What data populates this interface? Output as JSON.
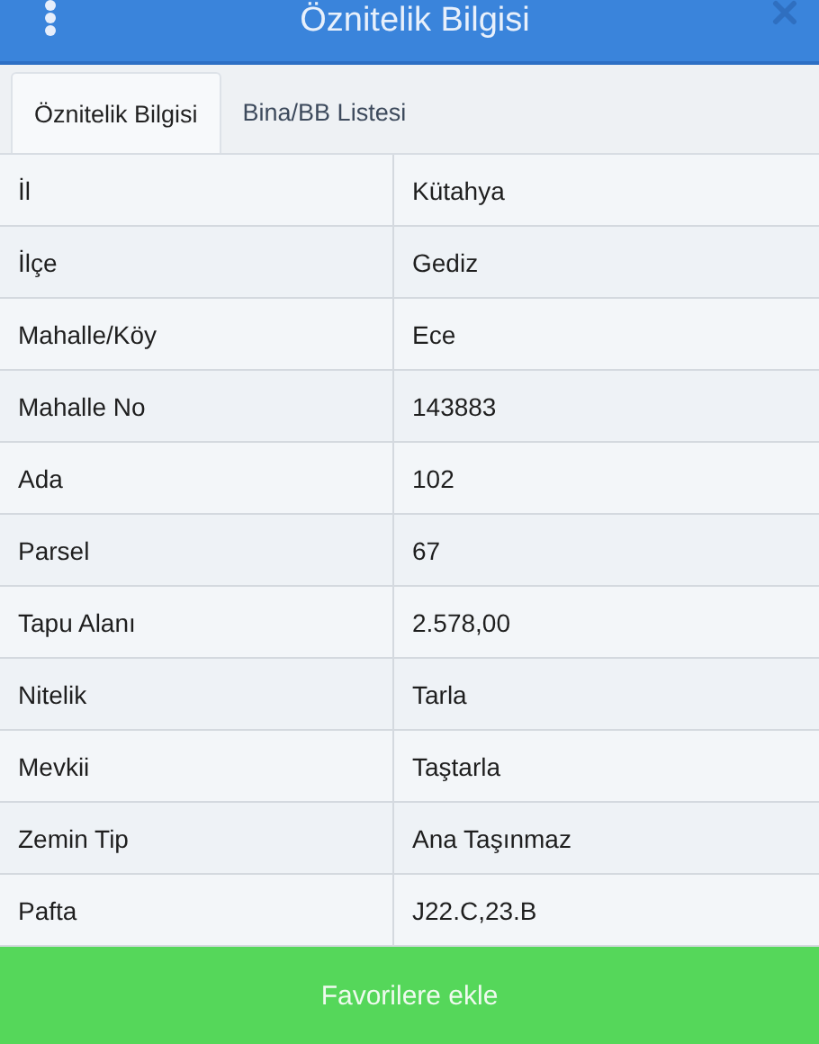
{
  "header": {
    "title": "Öznitelik Bilgisi"
  },
  "tabs": [
    {
      "label": "Öznitelik Bilgisi",
      "selected": true
    },
    {
      "label": "Bina/BB Listesi",
      "selected": false
    }
  ],
  "rows": [
    {
      "label": "İl",
      "value": "Kütahya"
    },
    {
      "label": "İlçe",
      "value": "Gediz"
    },
    {
      "label": "Mahalle/Köy",
      "value": "Ece"
    },
    {
      "label": "Mahalle No",
      "value": "143883"
    },
    {
      "label": "Ada",
      "value": "102"
    },
    {
      "label": "Parsel",
      "value": "67"
    },
    {
      "label": "Tapu Alanı",
      "value": "2.578,00"
    },
    {
      "label": "Nitelik",
      "value": "Tarla"
    },
    {
      "label": "Mevkii",
      "value": "Taştarla"
    },
    {
      "label": "Zemin Tip",
      "value": "Ana Taşınmaz"
    },
    {
      "label": "Pafta",
      "value": "J22.C,23.B"
    }
  ],
  "button": {
    "label": "Favorilere ekle"
  }
}
